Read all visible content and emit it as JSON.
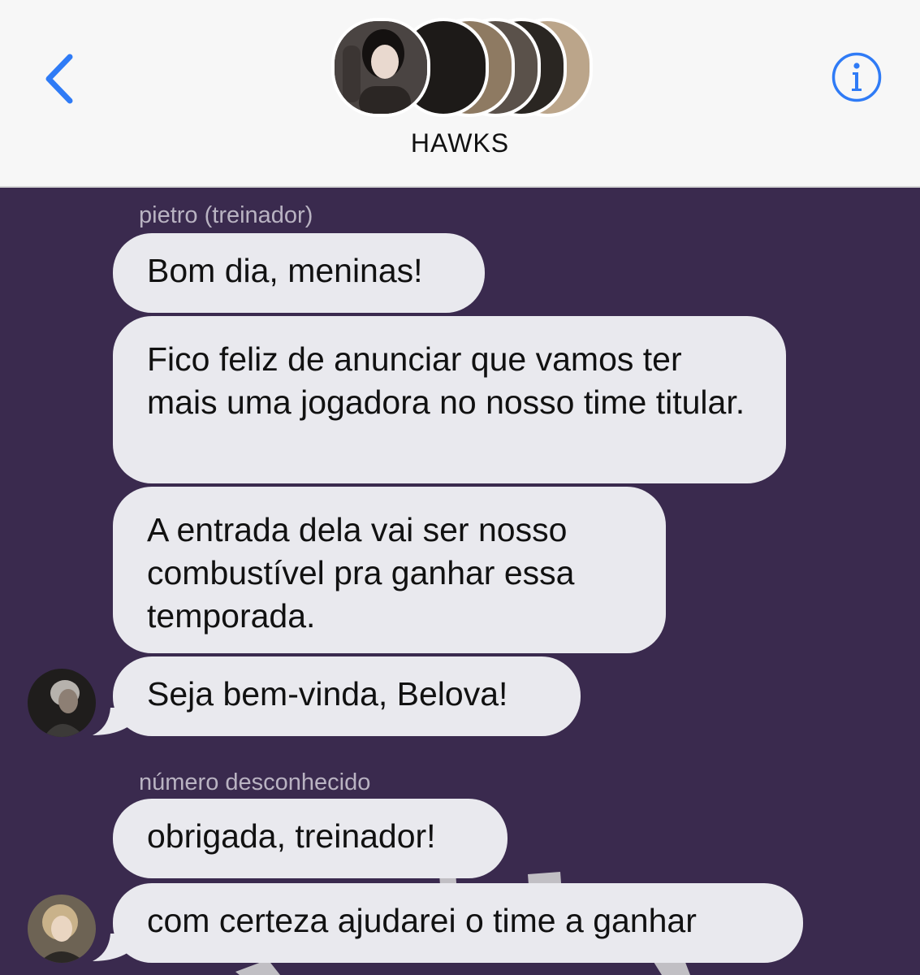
{
  "header": {
    "group_name": "HAWKS",
    "back_icon": "chevron-left-icon",
    "info_icon": "info-circle-icon",
    "accent_color": "#2f7bf6",
    "member_avatar_count": 6
  },
  "chat": {
    "background_color": "#3a2a4e",
    "bubble_color": "#e9e9ee",
    "sender_name_color": "#b9b3c2",
    "groups": [
      {
        "sender": "pietro (treinador)",
        "messages": [
          "Bom dia, meninas!",
          "Fico feliz de anunciar que vamos ter mais uma jogadora no nosso time titular.",
          "A entrada dela vai ser nosso combustível pra ganhar essa temporada.",
          "Seja bem-vinda, Belova!"
        ]
      },
      {
        "sender": "número desconhecido",
        "messages": [
          "obrigada, treinador!",
          "com certeza ajudarei o time a ganhar"
        ]
      }
    ]
  }
}
